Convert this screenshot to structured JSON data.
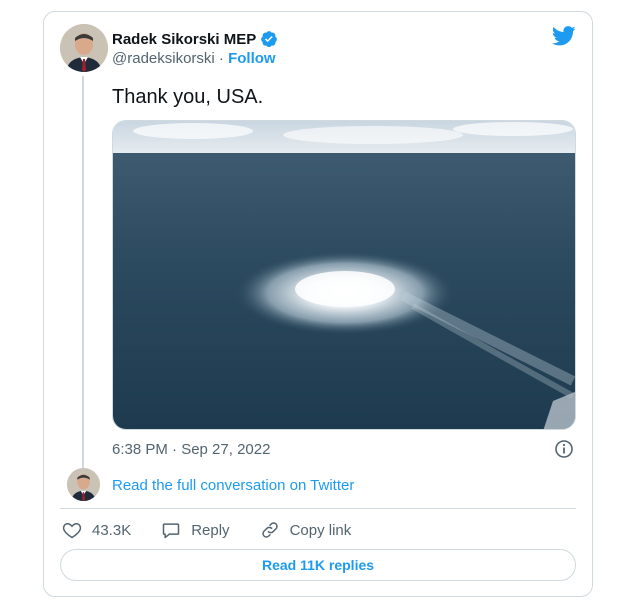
{
  "author": {
    "display_name": "Radek Sikorski MEP",
    "handle": "@radeksikorski",
    "separator": " · ",
    "follow_label": "Follow"
  },
  "tweet": {
    "text": "Thank you, USA.",
    "timestamp": "6:38 PM · Sep 27, 2022"
  },
  "conversation_link": "Read the full conversation on Twitter",
  "actions": {
    "likes": "43.3K",
    "reply": "Reply",
    "copy_link": "Copy link"
  },
  "replies_button": "Read 11K replies",
  "icons": {
    "brand": "twitter-bird-icon",
    "verified": "verified-badge-icon",
    "info": "info-icon",
    "like": "heart-icon",
    "reply": "speech-bubble-icon",
    "copy": "link-icon"
  },
  "colors": {
    "accent": "#1d9bf0",
    "text": "#0f1419",
    "muted": "#536471",
    "border": "#cfd9de"
  }
}
